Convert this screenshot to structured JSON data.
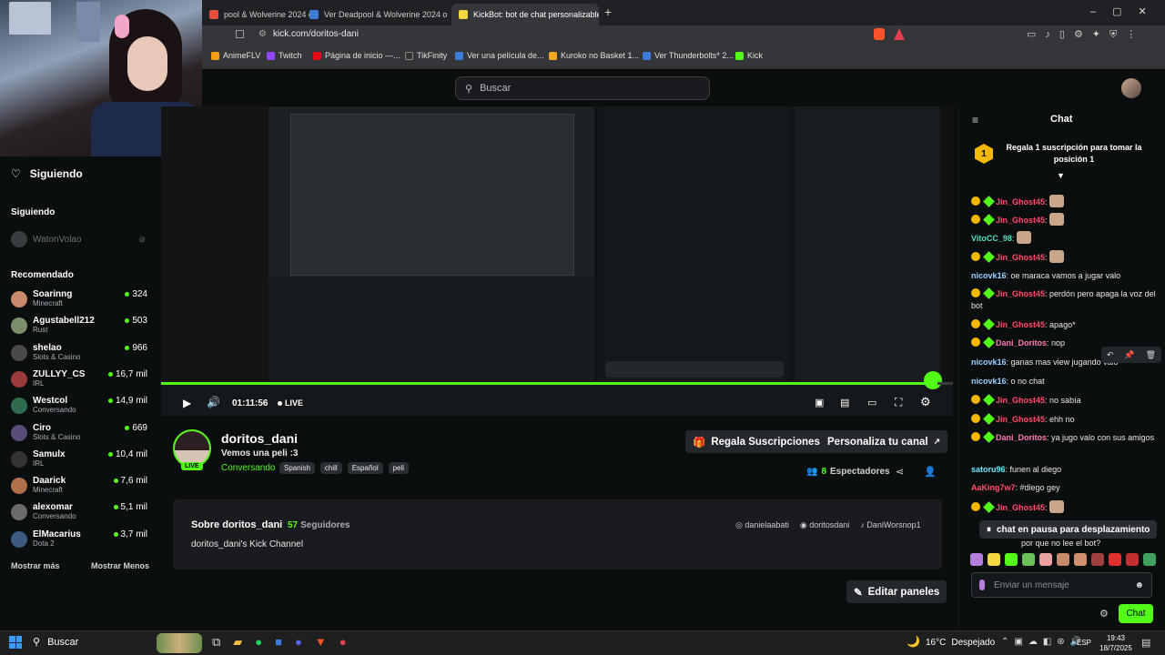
{
  "browser": {
    "tabs": [
      {
        "label": "pool & Wolverine 2024 onli",
        "active": false
      },
      {
        "label": "Ver Deadpool & Wolverine 2024 onli",
        "active": false
      },
      {
        "label": "KickBot: bot de chat personalizable p",
        "active": true
      }
    ],
    "url": "kick.com/doritos-dani",
    "bookmarks": [
      "AnimeFLV",
      "Twitch",
      "Página de inicio —...",
      "TikFinity",
      "Ver una película de...",
      "Kuroko no Basket 1...",
      "Ver Thunderbolts* 2...",
      "Kick"
    ]
  },
  "header": {
    "search_placeholder": "Buscar"
  },
  "sidebar": {
    "following_title": "Siguiendo",
    "following_section": "Siguiendo",
    "following_channel": "WatonVolao",
    "recommended_title": "Recomendado",
    "channels": [
      {
        "name": "Soarinng",
        "category": "Minecraft",
        "viewers": "324",
        "color": "#c98a6b"
      },
      {
        "name": "Agustabell212",
        "category": "Rust",
        "viewers": "503",
        "color": "#7b8e6a"
      },
      {
        "name": "shelao",
        "category": "Slots & Casino",
        "viewers": "966",
        "color": "#4a4a4a"
      },
      {
        "name": "ZULLYY_CS",
        "category": "IRL",
        "viewers": "16,7 mil",
        "color": "#9b3a3a"
      },
      {
        "name": "Westcol",
        "category": "Conversando",
        "viewers": "14,9 mil",
        "color": "#2e6b4f"
      },
      {
        "name": "Ciro",
        "category": "Slots & Casino",
        "viewers": "669",
        "color": "#5a4d7a"
      },
      {
        "name": "Samulx",
        "category": "IRL",
        "viewers": "10,4 mil",
        "color": "#333333"
      },
      {
        "name": "Daarick",
        "category": "Minecraft",
        "viewers": "7,6 mil",
        "color": "#b0704a"
      },
      {
        "name": "alexomar",
        "category": "Conversando",
        "viewers": "5,1 mil",
        "color": "#6b6b6b"
      },
      {
        "name": "ElMacarius",
        "category": "Dota 2",
        "viewers": "3,7 mil",
        "color": "#3d5a80"
      }
    ],
    "show_more": "Mostrar más",
    "show_less": "Mostrar Menos"
  },
  "player": {
    "time": "01:11:56",
    "live_label": "LIVE",
    "progress": 0.98
  },
  "stream": {
    "channel_name": "doritos_dani",
    "title": "Vemos una peli :3",
    "category": "Conversando",
    "tags": [
      "Spanish",
      "chill",
      "Español",
      "peli"
    ],
    "live_badge": "LIVE",
    "gift_button": "Regala Suscripciones",
    "customize_button": "Personaliza tu canal",
    "viewers_count": "8",
    "viewers_label": "Espectadores"
  },
  "about": {
    "title": "Sobre doritos_dani",
    "followers_count": "57",
    "followers_label": "Seguidores",
    "description": "doritos_dani's Kick Channel",
    "socials": [
      "danielaabati",
      "doritosdani",
      "DaniWorsnop1"
    ],
    "edit_panels": "Editar paneles"
  },
  "chat": {
    "title": "Chat",
    "gift_banner": "Regala 1 suscripción para tomar la posición 1",
    "gift_rank": "1",
    "messages": [
      {
        "user": "Jin_Ghost45",
        "color": "#ff4d6d",
        "text": "",
        "emote": true,
        "badges": true
      },
      {
        "user": "Jin_Ghost45",
        "color": "#ff4d6d",
        "text": "",
        "emote": true,
        "badges": true
      },
      {
        "user": "VitoCC_98",
        "color": "#4ee0c0",
        "text": "",
        "emote": true,
        "badges": false
      },
      {
        "user": "Jin_Ghost45",
        "color": "#ff4d6d",
        "text": "",
        "emote": true,
        "badges": true
      },
      {
        "user": "nicovk16",
        "color": "#9ad0ff",
        "text": "oe maraca vamos a jugar valo",
        "emote": false,
        "badges": false
      },
      {
        "user": "Jin_Ghost45",
        "color": "#ff4d6d",
        "text": "perdón pero apaga la voz del bot",
        "emote": false,
        "badges": true
      },
      {
        "user": "Jin_Ghost45",
        "color": "#ff4d6d",
        "text": "apago*",
        "emote": false,
        "badges": true
      },
      {
        "user": "Dani_Doritos",
        "color": "#ff7ab0",
        "text": "nop",
        "emote": false,
        "badges": true
      },
      {
        "user": "nicovk16",
        "color": "#9ad0ff",
        "text": "ganas mas view jugando valo",
        "emote": false,
        "badges": false
      },
      {
        "user": "nicovk16",
        "color": "#9ad0ff",
        "text": "o no chat",
        "emote": false,
        "badges": false
      },
      {
        "user": "Jin_Ghost45",
        "color": "#ff4d6d",
        "text": "no sabía",
        "emote": false,
        "badges": true
      },
      {
        "user": "Jin_Ghost45",
        "color": "#ff4d6d",
        "text": "ehh no",
        "emote": false,
        "badges": true
      },
      {
        "user": "Dani_Doritos",
        "color": "#ff7ab0",
        "text": "ya jugo valo con sus amigos",
        "emote": false,
        "badges": true
      },
      {
        "user": "satoru96",
        "color": "#6ee7ff",
        "text": "funen al diego",
        "emote": false,
        "badges": false
      },
      {
        "user": "AaKing7w7",
        "color": "#ff4d6d",
        "text": "#diego gey",
        "emote": false,
        "badges": false
      },
      {
        "user": "Jin_Ghost45",
        "color": "#ff4d6d",
        "text": "",
        "emote": true,
        "badges": true
      }
    ],
    "paused_label": "chat en pausa para desplazamiento",
    "partial_last": "por que no lee el bot?",
    "input_placeholder": "Enviar un mensaje",
    "send_button": "Chat"
  },
  "taskbar": {
    "search": "Buscar",
    "weather_temp": "16°C",
    "weather_desc": "Despejado",
    "lang": "ESP",
    "time": "19:43",
    "date": "18/7/2025"
  },
  "colors": {
    "kick_green": "#53fc18",
    "bg": "#0b0e0f",
    "panel": "#191b1f"
  }
}
